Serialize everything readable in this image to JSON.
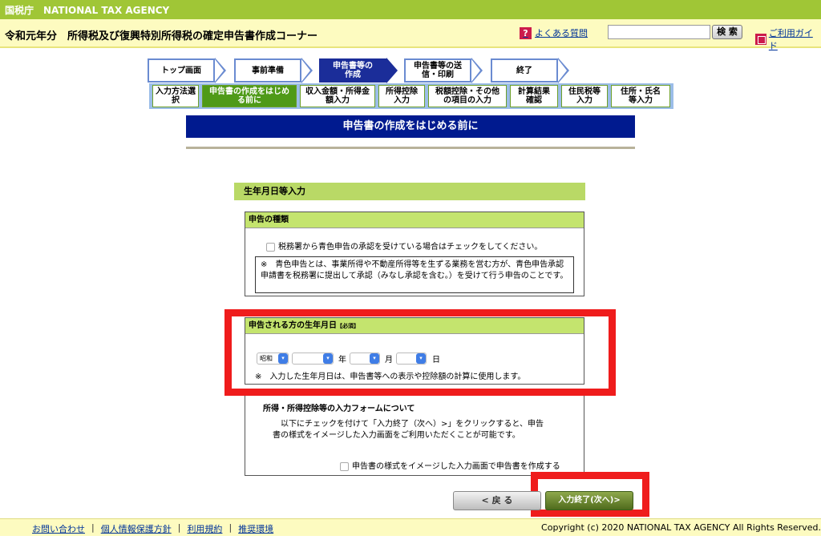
{
  "agency": "国税庁　NATIONAL TAX AGENCY",
  "header": {
    "title": "令和元年分　所得税及び復興特別所得税の確定申告書作成コーナー",
    "faq": "よくある質問",
    "search_btn": "検 索",
    "guide": "ご利用ガイド"
  },
  "steps": [
    "トップ画面",
    "事前準備",
    "申告書等の作成",
    "申告書等の送信・印刷",
    "終了"
  ],
  "substeps": [
    "入力方法選択",
    "申告書の作成をはじめる前に",
    "収入金額・所得金額入力",
    "所得控除入力",
    "税額控除・その他の項目の入力",
    "計算結果確認",
    "住民税等入力",
    "住所・氏名等入力"
  ],
  "page_title": "申告書の作成をはじめる前に",
  "section_label": "生年月日等入力",
  "declaration": {
    "heading": "申告の種類",
    "checkbox_label": "税務署から青色申告の承認を受けている場合はチェックをしてください。",
    "note": "※　青色申告とは、事業所得や不動産所得等を生ずる業務を営む方が、青色申告承認申請書を税務署に提出して承認（みなし承認を含む。）を受けて行う申告のことです。"
  },
  "birthdate": {
    "heading": "申告される方の生年月日",
    "required": "【必須】",
    "era_selected": "昭和",
    "year_unit": "年",
    "month_unit": "月",
    "day_unit": "日",
    "note": "※　入力した生年月日は、申告書等への表示や控除額の計算に使用します。"
  },
  "form_info": {
    "heading": "所得・所得控除等の入力フォームについて",
    "text": "以下にチェックを付けて「入力終了（次へ）>」をクリックすると、申告書の様式をイメージした入力画面をご利用いただくことが可能です。",
    "checkbox_label": "申告書の様式をイメージした入力画面で申告書を作成する"
  },
  "buttons": {
    "back": "< 戻 る",
    "next": "入力終了(次へ)>"
  },
  "footer": {
    "links": [
      "お問い合わせ",
      "個人情報保護方針",
      "利用規約",
      "推奨環境"
    ],
    "copyright": "Copyright (c) 2020 NATIONAL TAX AGENCY All Rights Reserved."
  },
  "colors": {
    "brand_green": "#a0c636",
    "nav_blue": "#1b2d99",
    "highlight_red": "#ef1c1c"
  }
}
